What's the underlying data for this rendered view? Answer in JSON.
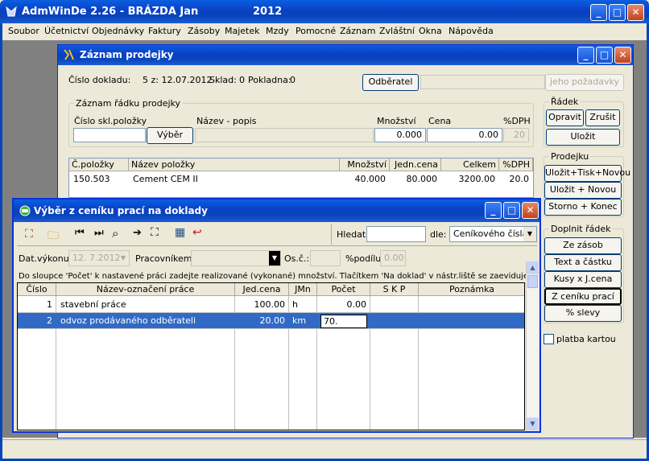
{
  "app": {
    "title": "AdmWinDe 2.26 - BRÁZDA Jan",
    "year": "2012"
  },
  "menu": [
    "Soubor",
    "Účetnictví",
    "Objednávky",
    "Faktury",
    "Zásoby",
    "Majetek",
    "Mzdy",
    "Pomocné",
    "Záznam",
    "Zvláštní",
    "Okna",
    "Nápověda"
  ],
  "sales": {
    "title": "Záznam prodejky",
    "doc_label": "Číslo dokladu:",
    "doc_value": "5 z: 12.07.2012",
    "stock_label": "Sklad:",
    "stock_value": "0",
    "register_label": "Pokladna:",
    "register_value": "0",
    "customer_button": "Odběratel",
    "requirements_button": "jeho požadavky",
    "line_group": "Záznam řádku prodejky",
    "col_item": "Číslo skl.položky",
    "col_name": "Název - popis",
    "col_qty": "Množství",
    "col_price": "Cena",
    "col_vat": "%DPH",
    "select_button": "Výběr",
    "qty_value": "0.000",
    "price_value": "0.00",
    "vat_value": "20",
    "row_group": "Řádek",
    "correct_button": "Opravit",
    "cancel_button": "Zrušit",
    "save_button": "Uložit",
    "receipt_group": "Prodejku",
    "save_print_new": "Uložit+Tisk+Novou",
    "save_new": "Uložit + Novou",
    "storno_end": "Storno + Konec",
    "fill_group": "Doplnit řádek",
    "from_stock": "Ze zásob",
    "text_amount": "Text a částku",
    "pieces_price": "Kusy x J.cena",
    "from_labor": "Z ceníku prací",
    "discount": "% slevy",
    "card_payment": "platba kartou",
    "table_headers": [
      "Č.položky",
      "Název položky",
      "Množství",
      "Jedn.cena",
      "Celkem",
      "%DPH"
    ],
    "table_rows": [
      {
        "item": "150.503",
        "name": "Cement CEM II",
        "qty": "40.000",
        "unit_price": "80.000",
        "total": "3200.00",
        "vat": "20.0"
      }
    ]
  },
  "picker": {
    "title": "Výběr z ceníku prací na doklady",
    "search_label": "Hledat:",
    "by_label": "dle:",
    "by_value": "Ceníkového čísla",
    "date_label": "Dat.výkonu:",
    "date_value": "12. 7.2012",
    "worker_label": "Pracovníkem:",
    "personal_label": "Os.č.:",
    "share_label": "%podílu:",
    "share_value": "0.00",
    "hint": "Do sloupce 'Počet' k nastavené práci zadejte realizované (vykonané) množství. Tlačítkem 'Na doklad' v nástr.liště se zaeviduje.",
    "headers": [
      "Číslo",
      "Název-označení práce",
      "Jed.cena",
      "JMn",
      "Počet",
      "S K P",
      "Poznámka"
    ],
    "rows": [
      {
        "no": "1",
        "name": "stavební práce",
        "price": "100.00",
        "unit": "h",
        "count": "0.00",
        "skp": "",
        "note": ""
      },
      {
        "no": "2",
        "name": "odvoz prodávaného odběrateli",
        "price": "20.00",
        "unit": "km",
        "count": "70.",
        "skp": "",
        "note": ""
      }
    ]
  }
}
